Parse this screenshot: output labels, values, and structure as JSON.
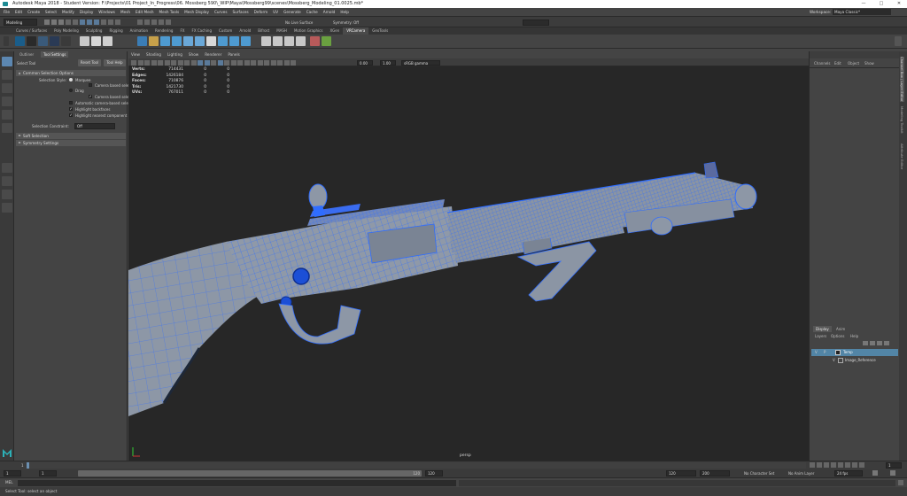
{
  "window": {
    "title": "Autodesk Maya 2018 - Student Version: F:\\Projects\\01 Project_In_Progress\\06. Mossberg 590\\_WIP\\Maya\\Mossberg99\\scenes\\Mossberg_Modeling_01.0025.mb*"
  },
  "menubar": {
    "items": [
      "File",
      "Edit",
      "Create",
      "Select",
      "Modify",
      "Display",
      "Windows",
      "Mesh",
      "Edit Mesh",
      "Mesh Tools",
      "Mesh Display",
      "Curves",
      "Surfaces",
      "Deform",
      "UV",
      "Generate",
      "Cache",
      "Arnold",
      "Help"
    ],
    "workspace_label": "Workspace:",
    "workspace_value": "Maya Classic*"
  },
  "statusline": {
    "mode": "Modeling",
    "live_surface": "No Live Surface",
    "symmetry": "Symmetry: Off"
  },
  "shelf": {
    "tabs": [
      "Curves / Surfaces",
      "Poly Modeling",
      "Sculpting",
      "Rigging",
      "Animation",
      "Rendering",
      "FX",
      "FX Caching",
      "Custom",
      "Arnold",
      "Bifrost",
      "MASH",
      "Motion Graphics",
      "XGen",
      "VRCamera",
      "GeoTools"
    ],
    "active_tab": "VRCamera",
    "labels_left": [
      "CP",
      "Quixel",
      "MESH",
      "PIVOT",
      "RSN",
      "WRITE",
      "FT"
    ],
    "labels_mid": [
      "ZOOP",
      "PR",
      "INU",
      "SHOW",
      "XRay"
    ]
  },
  "attr": {
    "tabs": [
      "Outliner",
      "Tool Settings"
    ],
    "active_tab": "Tool Settings",
    "tool_name": "Select Tool",
    "reset_button": "Reset Tool",
    "help_button": "Tool Help",
    "sections": {
      "common": "Common Selection Options",
      "soft": "Soft Selection",
      "symmetry": "Symmetry Settings"
    },
    "selection_style_label": "Selection Style:",
    "marquee": "Marquee",
    "camera_based": "Camera based selection",
    "drag": "Drag",
    "camera_based_2": "Camera based selection",
    "auto_camera": "Automatic camera-based select",
    "highlight_backfaces": "Highlight backfaces",
    "highlight_nearest": "Highlight nearest component",
    "constraint_label": "Selection Constraint:",
    "constraint_value": "Off"
  },
  "viewport": {
    "menu": [
      "View",
      "Shading",
      "Lighting",
      "Show",
      "Renderer",
      "Panels"
    ],
    "exposure": "0.00",
    "gamma": "1.00",
    "color_space": "sRGB gamma",
    "camera": "persp",
    "hud": [
      {
        "k": "Verts:",
        "v": "714431",
        "a": "0",
        "b": "0"
      },
      {
        "k": "Edges:",
        "v": "1426184",
        "a": "0",
        "b": "0"
      },
      {
        "k": "Faces:",
        "v": "710876",
        "a": "0",
        "b": "0"
      },
      {
        "k": "Tris:",
        "v": "1421730",
        "a": "0",
        "b": "0"
      },
      {
        "k": "UVs:",
        "v": "767011",
        "a": "0",
        "b": "0"
      }
    ]
  },
  "channelbox": {
    "tabs": [
      "Channels",
      "Edit",
      "Object",
      "Show"
    ],
    "layer_tabs": [
      "Display",
      "Anim"
    ],
    "layer_menu": [
      "Layers",
      "Options",
      "Help"
    ],
    "layers": [
      {
        "v": "V",
        "p": "P",
        "name": "Temp",
        "selected": true
      },
      {
        "v": "V",
        "p": "",
        "name": "Image_Reference",
        "selected": false
      }
    ]
  },
  "sidestrip": {
    "labels": [
      "Channel Box / Layer Editor",
      "Modeling Toolkit",
      "Attribute Editor"
    ]
  },
  "timeline": {
    "start": "1",
    "current": "1",
    "range_start": "1",
    "range_end": "120",
    "anim_end": "120",
    "max_end": "200",
    "character_set": "No Character Set",
    "anim_layer": "No Anim Layer",
    "fps": "24 fps"
  },
  "mel": {
    "label": "MEL"
  },
  "helpline": {
    "text": "Select Tool: select an object"
  },
  "colors": {
    "wire": "#2f6dff",
    "mesh": "#8b96a6",
    "selected_layer": "#5285a6"
  }
}
